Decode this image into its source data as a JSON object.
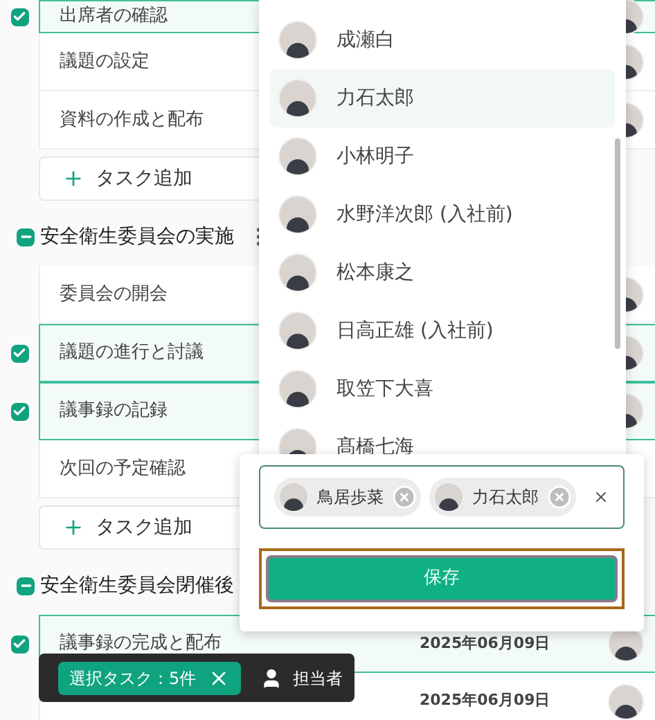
{
  "tasks": [
    {
      "kind": "task",
      "title": "出席者の確認",
      "checked": true,
      "avatar": true
    },
    {
      "kind": "task",
      "title": "議題の設定",
      "checked": false,
      "avatar": true
    },
    {
      "kind": "task",
      "title": "資料の作成と配布",
      "checked": false,
      "avatar": true
    },
    {
      "kind": "add",
      "title": "タスク追加"
    },
    {
      "kind": "section",
      "title": "安全衛生委員会の実施",
      "indeterminate": true
    },
    {
      "kind": "task",
      "title": "委員会の開会",
      "checked": false,
      "avatar": true
    },
    {
      "kind": "task",
      "title": "議題の進行と討議",
      "checked": true,
      "avatar": true
    },
    {
      "kind": "task",
      "title": "議事録の記録",
      "checked": true,
      "avatar": true
    },
    {
      "kind": "task",
      "title": "次回の予定確認",
      "checked": false,
      "avatar": false
    },
    {
      "kind": "add",
      "title": "タスク追加"
    },
    {
      "kind": "section",
      "title": "安全衛生委員会閉催後",
      "indeterminate": true
    },
    {
      "kind": "task",
      "title": "議事録の完成と配布",
      "checked": true,
      "avatar": true,
      "date": "2025年06月09日"
    },
    {
      "kind": "task",
      "checked": false,
      "avatar": true,
      "date": "2025年06月09日"
    }
  ],
  "members": [
    {
      "name": "成瀬白",
      "selected": false
    },
    {
      "name": "力石太郎",
      "selected": true
    },
    {
      "name": "小林明子",
      "selected": false
    },
    {
      "name": "水野洋次郎 (入社前)",
      "selected": false
    },
    {
      "name": "松本康之",
      "selected": false
    },
    {
      "name": "日高正雄 (入社前)",
      "selected": false
    },
    {
      "name": "取笠下大喜",
      "selected": false
    },
    {
      "name": "髙橋七海",
      "selected": false
    }
  ],
  "assignee_field": {
    "chips": [
      "鳥居歩菜",
      "力石太郎"
    ]
  },
  "save_button": "保存",
  "selection_bar": {
    "count_label": "選択タスク：5件",
    "assignee_button": "担当者"
  }
}
